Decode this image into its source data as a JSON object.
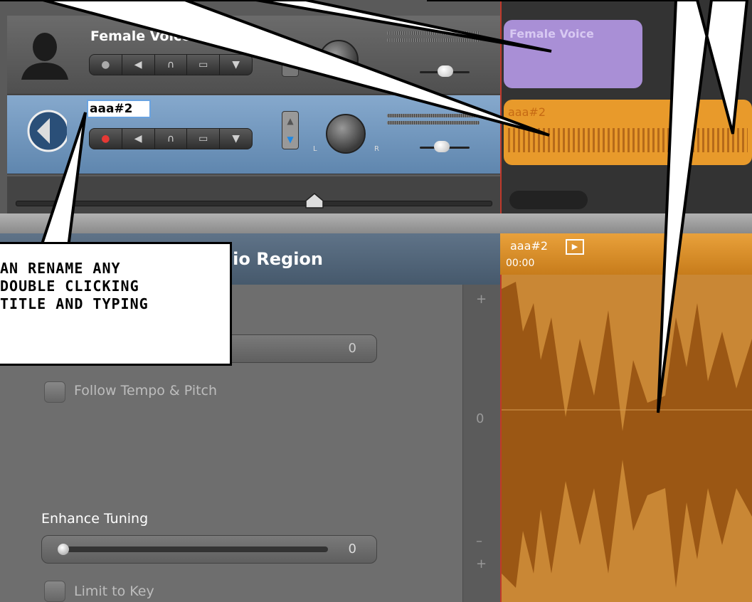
{
  "tracks": [
    {
      "name": "Female Voice",
      "region_label": "Female Voice",
      "color": "#a98fd6"
    },
    {
      "name": "aaa#2",
      "region_label": "aaa#2",
      "color": "#e89a2b"
    }
  ],
  "rename_field_value": "aaa#2",
  "editor": {
    "title": "dio Region",
    "region_label": "aaa#2",
    "timecode": "00:00",
    "slider1_value": "0",
    "follow_tempo_label": "Follow Tempo & Pitch",
    "enhance_tuning_label": "Enhance Tuning",
    "enhance_tuning_value": "0",
    "limit_to_key_label": "Limit to Key"
  },
  "scale": {
    "top_plus": "+",
    "zero": "0",
    "minus": "–",
    "bottom_plus": "+"
  },
  "callout": {
    "lines": [
      "AN RENAME ANY",
      "DOUBLE CLICKING",
      "TITLE AND TYPING"
    ]
  },
  "meters": {
    "L": "L",
    "R": "R"
  },
  "colors": {
    "accent": "#c0392b",
    "audio_region": "#e89a2b",
    "voice_region": "#a98fd6",
    "editor_header": "#52667a"
  }
}
